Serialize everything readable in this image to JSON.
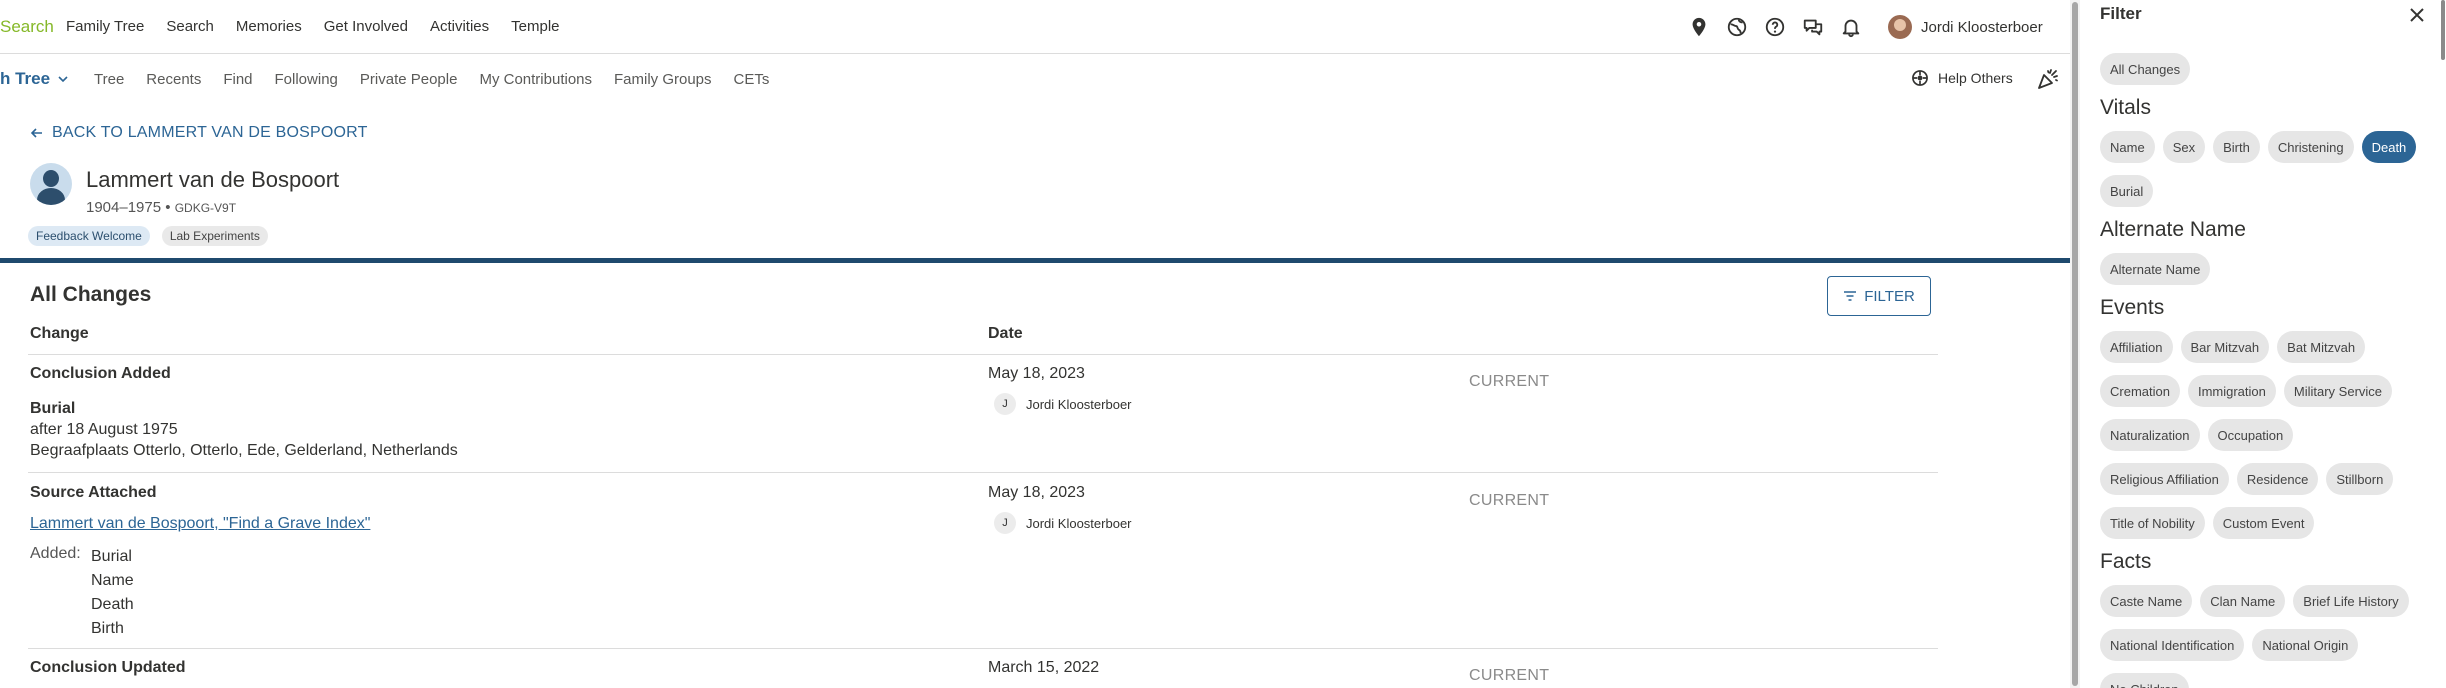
{
  "topnav": {
    "brand": "Search",
    "links": [
      "Family Tree",
      "Search",
      "Memories",
      "Get Involved",
      "Activities",
      "Temple"
    ],
    "icons": [
      "location-pin-icon",
      "globe-icon",
      "help-circle-icon",
      "chat-icon",
      "bell-icon"
    ],
    "user_name": "Jordi Kloosterboer"
  },
  "subnav": {
    "section": "h Tree",
    "links": [
      "Tree",
      "Recents",
      "Find",
      "Following",
      "Private People",
      "My Contributions",
      "Family Groups",
      "CETs"
    ],
    "help_label": "Help Others"
  },
  "person": {
    "back_label": "BACK TO LAMMERT VAN DE BOSPOORT",
    "name": "Lammert van de Bospoort",
    "lifespan": "1904–1975",
    "separator": "•",
    "pid": "GDKG-V9T",
    "badges": [
      "Feedback Welcome",
      "Lab Experiments"
    ]
  },
  "changes": {
    "title": "All Changes",
    "filter_label": "FILTER",
    "col_change": "Change",
    "col_date": "Date",
    "rows": [
      {
        "type": "Conclusion Added",
        "detail_title": "Burial",
        "detail_lines": [
          "after 18 August 1975",
          "Begraafplaats Otterlo, Otterlo, Ede, Gelderland, Netherlands"
        ],
        "date": "May 18, 2023",
        "contributor_initial": "J",
        "contributor": "Jordi Kloosterboer",
        "status": "CURRENT"
      },
      {
        "type": "Source Attached",
        "source_link": "Lammert van de Bospoort, \"Find a Grave Index\"",
        "added_label": "Added:",
        "added_items": [
          "Burial",
          "Name",
          "Death",
          "Birth"
        ],
        "date": "May 18, 2023",
        "contributor_initial": "J",
        "contributor": "Jordi Kloosterboer",
        "status": "CURRENT"
      },
      {
        "type": "Conclusion Updated",
        "date": "March 15, 2022",
        "status": "CURRENT"
      }
    ]
  },
  "filter": {
    "title": "Filter",
    "all_changes": "All Changes",
    "groups": [
      {
        "title": "Vitals",
        "chips": [
          "Name",
          "Sex",
          "Birth",
          "Christening",
          "Death",
          "Burial"
        ],
        "active": "Death"
      },
      {
        "title": "Alternate Name",
        "chips": [
          "Alternate Name"
        ]
      },
      {
        "title": "Events",
        "chips": [
          "Affiliation",
          "Bar Mitzvah",
          "Bat Mitzvah",
          "Cremation",
          "Immigration",
          "Military Service",
          "Naturalization",
          "Occupation",
          "Religious Affiliation",
          "Residence",
          "Stillborn",
          "Title of Nobility",
          "Custom Event"
        ]
      },
      {
        "title": "Facts",
        "chips": [
          "Caste Name",
          "Clan Name",
          "Brief Life History",
          "National Identification",
          "National Origin",
          "No Children"
        ]
      }
    ],
    "active_color": "#2c6595"
  },
  "colors": {
    "brand_green": "#85b828",
    "link_blue": "#2c6595",
    "header_bar": "#1f4a6e",
    "status_gray": "#8a8a8a"
  }
}
